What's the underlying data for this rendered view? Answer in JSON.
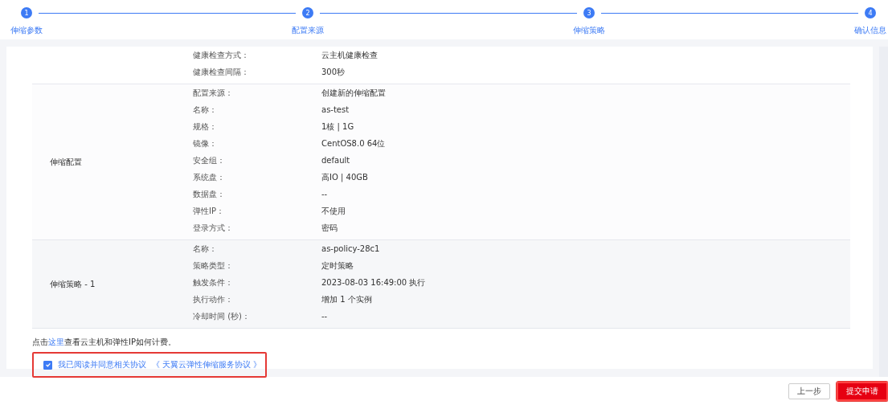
{
  "steps": [
    {
      "number": "1",
      "label": "伸缩参数",
      "done": true
    },
    {
      "number": "2",
      "label": "配置来源",
      "done": true
    },
    {
      "number": "3",
      "label": "伸缩策略",
      "done": true
    },
    {
      "number": "4",
      "label": "确认信息",
      "done": true
    }
  ],
  "sections": [
    {
      "rows": [
        {
          "key": "健康检查方式：",
          "value": "云主机健康检查"
        },
        {
          "key": "健康检查间隔：",
          "value": "300秒"
        }
      ]
    },
    {
      "label": "伸缩配置",
      "rows": [
        {
          "key": "配置来源：",
          "value": "创建新的伸缩配置"
        },
        {
          "key": "名称：",
          "value": "as-test"
        },
        {
          "key": "规格：",
          "value": "1核 | 1G"
        },
        {
          "key": "镜像：",
          "value": "CentOS8.0 64位"
        },
        {
          "key": "安全组：",
          "value": "default"
        },
        {
          "key": "系统盘：",
          "value": "高IO | 40GB"
        },
        {
          "key": "数据盘：",
          "value": "--"
        },
        {
          "key": "弹性IP：",
          "value": "不使用"
        },
        {
          "key": "登录方式：",
          "value": "密码"
        }
      ]
    },
    {
      "label": "伸缩策略 - 1",
      "rows": [
        {
          "key": "名称：",
          "value": "as-policy-28c1"
        },
        {
          "key": "策略类型：",
          "value": "定时策略"
        },
        {
          "key": "触发条件：",
          "value": "2023-08-03 16:49:00 执行"
        },
        {
          "key": "执行动作：",
          "value": "增加 1 个实例"
        },
        {
          "key": "冷却时间 (秒)：",
          "value": "--"
        }
      ]
    }
  ],
  "billing_note": {
    "before": "点击",
    "link": "这里",
    "after": "查看云主机和弹性IP如何计费。"
  },
  "agreement": {
    "checked": true,
    "label": "我已阅读并同意相关协议",
    "link": "《 天翼云弹性伸缩服务协议 》"
  },
  "buttons": [
    {
      "kind": "secondary",
      "label": "上一步"
    },
    {
      "kind": "primary",
      "label": "提交申请"
    }
  ]
}
